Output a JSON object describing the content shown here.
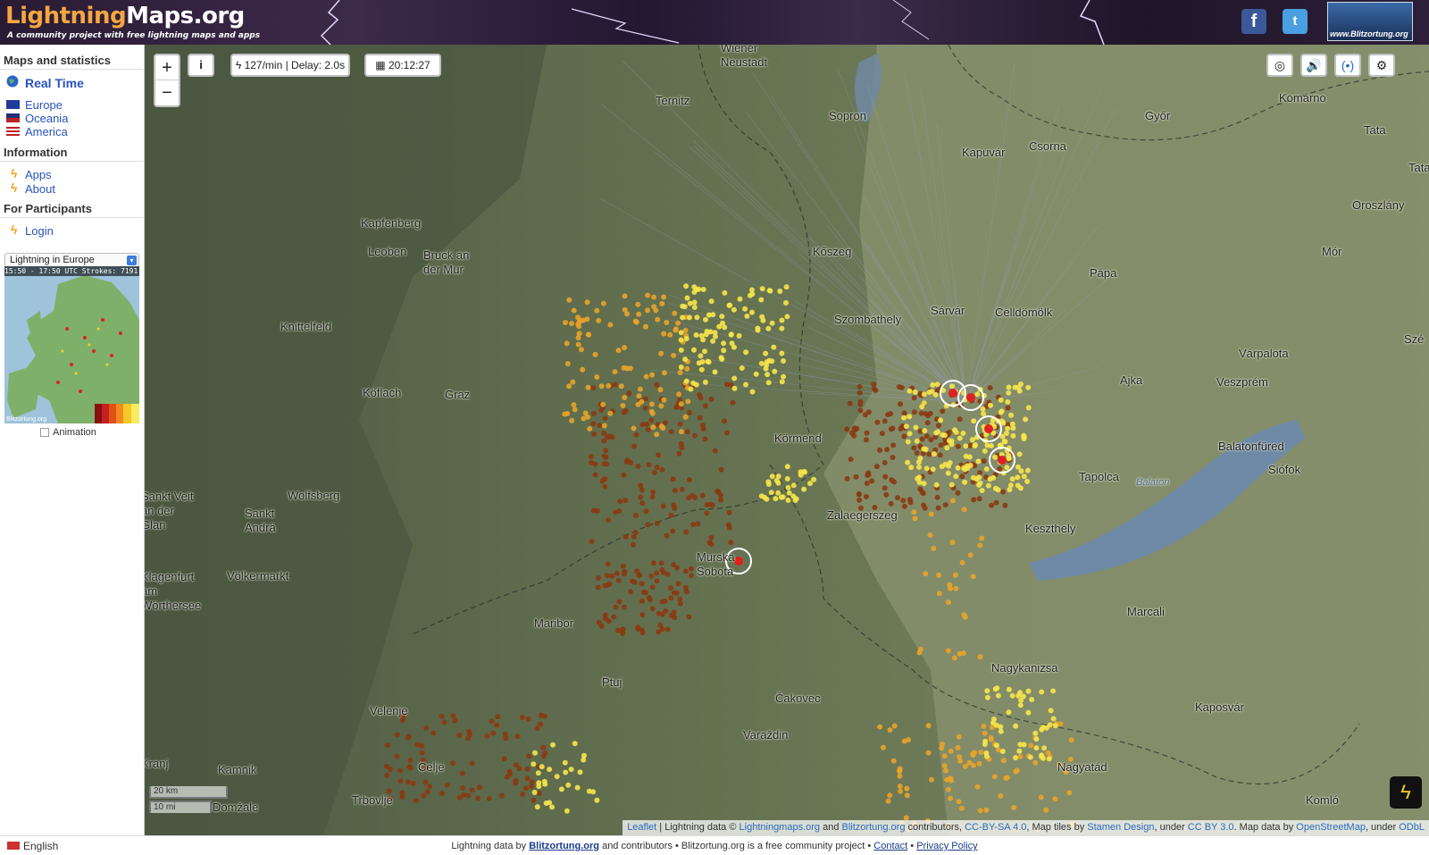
{
  "header": {
    "logo_part1": "Lightning",
    "logo_part2": "Maps.org",
    "tagline": "A community project with free lightning maps and apps",
    "facebook": "f",
    "twitter": "t",
    "blitzortung_banner": "www.Blitzortung.org"
  },
  "sidebar": {
    "maps_heading": "Maps and statistics",
    "realtime": "Real Time",
    "regions": [
      "Europe",
      "Oceania",
      "America"
    ],
    "info_heading": "Information",
    "info_links": [
      "Apps",
      "About"
    ],
    "participants_heading": "For Participants",
    "login": "Login",
    "select_value": "Lightning in Europe",
    "thumb_caption": "15:50 - 17:50 UTC Strokes: 7191",
    "thumb_footer": "Blitzortung.org",
    "animation_label": "Animation"
  },
  "map_controls": {
    "zoom_in": "+",
    "zoom_out": "−",
    "info": "i",
    "rate": "127/min | Delay: 2.0s",
    "time": "20:12:27"
  },
  "map_labels": [
    "Wiener Neustadt",
    "Ternitz",
    "Sopron",
    "Győr",
    "Komárno",
    "Tata",
    "Tata",
    "Kapuvár",
    "Csorna",
    "Oroszlány",
    "Kapfenberg",
    "Leoben",
    "Bruck an der Mur",
    "Kőszeg",
    "Pápa",
    "Mór",
    "Knittelfeld",
    "Szombathely",
    "Sárvár",
    "Celldömölk",
    "Szé",
    "Várpalota",
    "Köflach",
    "Graz",
    "Ajka",
    "Veszprém",
    "Körmend",
    "Balatonfüred",
    "Tapolca",
    "Siófok",
    "Sankt Veit an der Glan",
    "Wolfsberg",
    "Sankt Andrä",
    "Zalaegerszeg",
    "Keszthely",
    "Balaton",
    "Klagenfurt am Wörthersee",
    "Völkermarkt",
    "Murska Sobota",
    "Marcali",
    "Maribor",
    "Ptuj",
    "Nagykanizsa",
    "Velenje",
    "Čakovec",
    "Kaposvár",
    "Varaždin",
    "Kranj",
    "Kamnik",
    "Celje",
    "Nagyatád",
    "Trbovlje",
    "Domžale",
    "Komló"
  ],
  "scale": {
    "km": "20 km",
    "mi": "10 mi"
  },
  "attribution": {
    "leaflet": "Leaflet",
    "text1": " | Lightning data © ",
    "lm": "Lightningmaps.org",
    "and": " and ",
    "bo": "Blitzortung.org",
    "text2": " contributors, ",
    "ccbysa": "CC-BY-SA 4.0",
    "text3": ", Map tiles by ",
    "stamen": "Stamen Design",
    "text4": ", under ",
    "ccby": "CC BY 3.0",
    "text5": ". Map data by ",
    "osm": "OpenStreetMap",
    "text6": ", under ",
    "odbl": "ODbL"
  },
  "footer": {
    "language": "English",
    "prefix": "Lightning data by ",
    "bo": "Blitzortung.org",
    "middle": " and contributors • Blitzortung.org is a free community project • ",
    "contact": "Contact",
    "sep": " • ",
    "privacy": "Privacy Policy"
  },
  "colors": {
    "map_bg": "#6d7a5e",
    "lake": "#6f8aa6",
    "strike_new": "#f6e64a",
    "strike_mid": "#e8a32a",
    "strike_old": "#8a3a12",
    "logo_orange": "#f4a640",
    "link_blue": "#2a52be"
  }
}
